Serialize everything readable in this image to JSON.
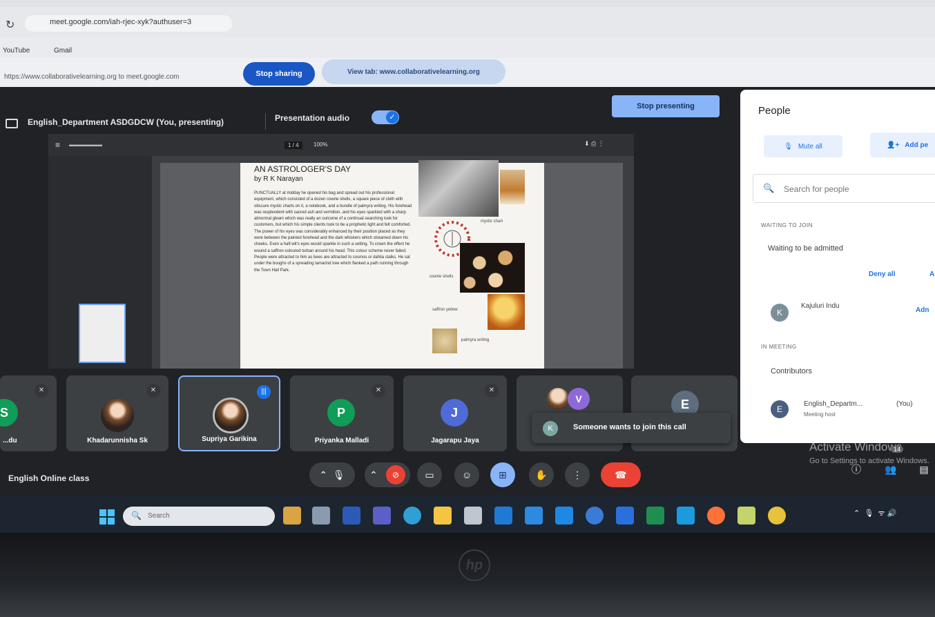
{
  "browser": {
    "url": "meet.google.com/iah-rjec-xyk?authuser=3",
    "bookmarks": [
      "YouTube",
      "Gmail"
    ]
  },
  "share_banner": {
    "text": "https://www.collaborativelearning.org to meet.google.com",
    "stop_label": "Stop sharing",
    "view_tab_label": "View tab: www.collaborativelearning.org"
  },
  "presenter": {
    "title": "English_Department ASDGDCW (You, presenting)",
    "audio_label": "Presentation audio",
    "audio_on": true,
    "stop_label": "Stop presenting"
  },
  "pdf": {
    "page_indicator": "1 / 4",
    "zoom": "100%",
    "doc_title": "AN ASTROLOGER'S DAY",
    "doc_author": "by R K Narayan",
    "doc_body": "PUNCTUALLY at midday he opened his bag and spread out his professional equipment, which consisted of a dozen cowrie shells, a square piece of cloth with obscure mystic charts on it, a notebook, and a bundle of palmyra writing. His forehead was resplendent with sacred ash and vermilion, and his eyes sparkled with a sharp abnormal gleam which was really an outcome of a continual searching look for customers, but which his simple clients took to be a prophetic light and felt comforted. The power of his eyes was considerably enhanced by their position placed as they were between the painted forehead and the dark whiskers which streamed down his cheeks. Even a half-wit's eyes would sparkle in such a setting. To crown the effect he wound a saffron-coloured turban around his head. This colour scheme never failed. People were attracted to him as bees are attracted to cosmos or dahlia stalks. He sat under the boughs of a spreading tamarind tree which flanked a path running through the Town Hall Park.",
    "captions": {
      "chart": "mystic chart",
      "shells": "cowrie shells",
      "saffron": "saffron yellow",
      "palmyra": "palmyra writing"
    }
  },
  "participants": [
    {
      "name": "...du",
      "initial": "S",
      "color": "#0f9d58",
      "muted": true
    },
    {
      "name": "Khadarunnisha Sk",
      "photo": true,
      "muted": true
    },
    {
      "name": "Supriya Garikina",
      "photo": true,
      "speaking": true
    },
    {
      "name": "Priyanka Malladi",
      "initial": "P",
      "color": "#0f9d58",
      "muted": true
    },
    {
      "name": "Jagarapu Jaya",
      "initial": "J",
      "color": "#4f6bd8",
      "muted": true
    },
    {
      "name": "",
      "initial": "V",
      "color": "#8e6ad8",
      "photo": true
    },
    {
      "name": "",
      "initial": "E",
      "color": "#5f6d80"
    }
  ],
  "toast": {
    "initial": "K",
    "text": "Someone wants to join this call"
  },
  "people_panel": {
    "title": "People",
    "mute_all": "Mute all",
    "add_people": "Add pe",
    "search_placeholder": "Search for people",
    "waiting_section": "WAITING TO JOIN",
    "waiting_group": "Waiting to be admitted",
    "deny_all": "Deny all",
    "admit_all": "A",
    "waiting_person": {
      "name": "Kajuluri Indu",
      "initial": "K",
      "admit": "Adn"
    },
    "in_meeting_section": "IN MEETING",
    "contributors": "Contributors",
    "member": {
      "name": "English_Departm...",
      "tag": "(You)",
      "role": "Meeting host",
      "initial": "E"
    }
  },
  "bottom": {
    "meeting_name": "English Online class",
    "activate_title": "Activate Windows",
    "activate_sub": "Go to Settings to activate Windows.",
    "people_count": "14"
  },
  "taskbar": {
    "search": "Search"
  },
  "colors": {
    "meet_bg": "#202226",
    "accent": "#8ab4f8",
    "leave": "#ea4335"
  }
}
